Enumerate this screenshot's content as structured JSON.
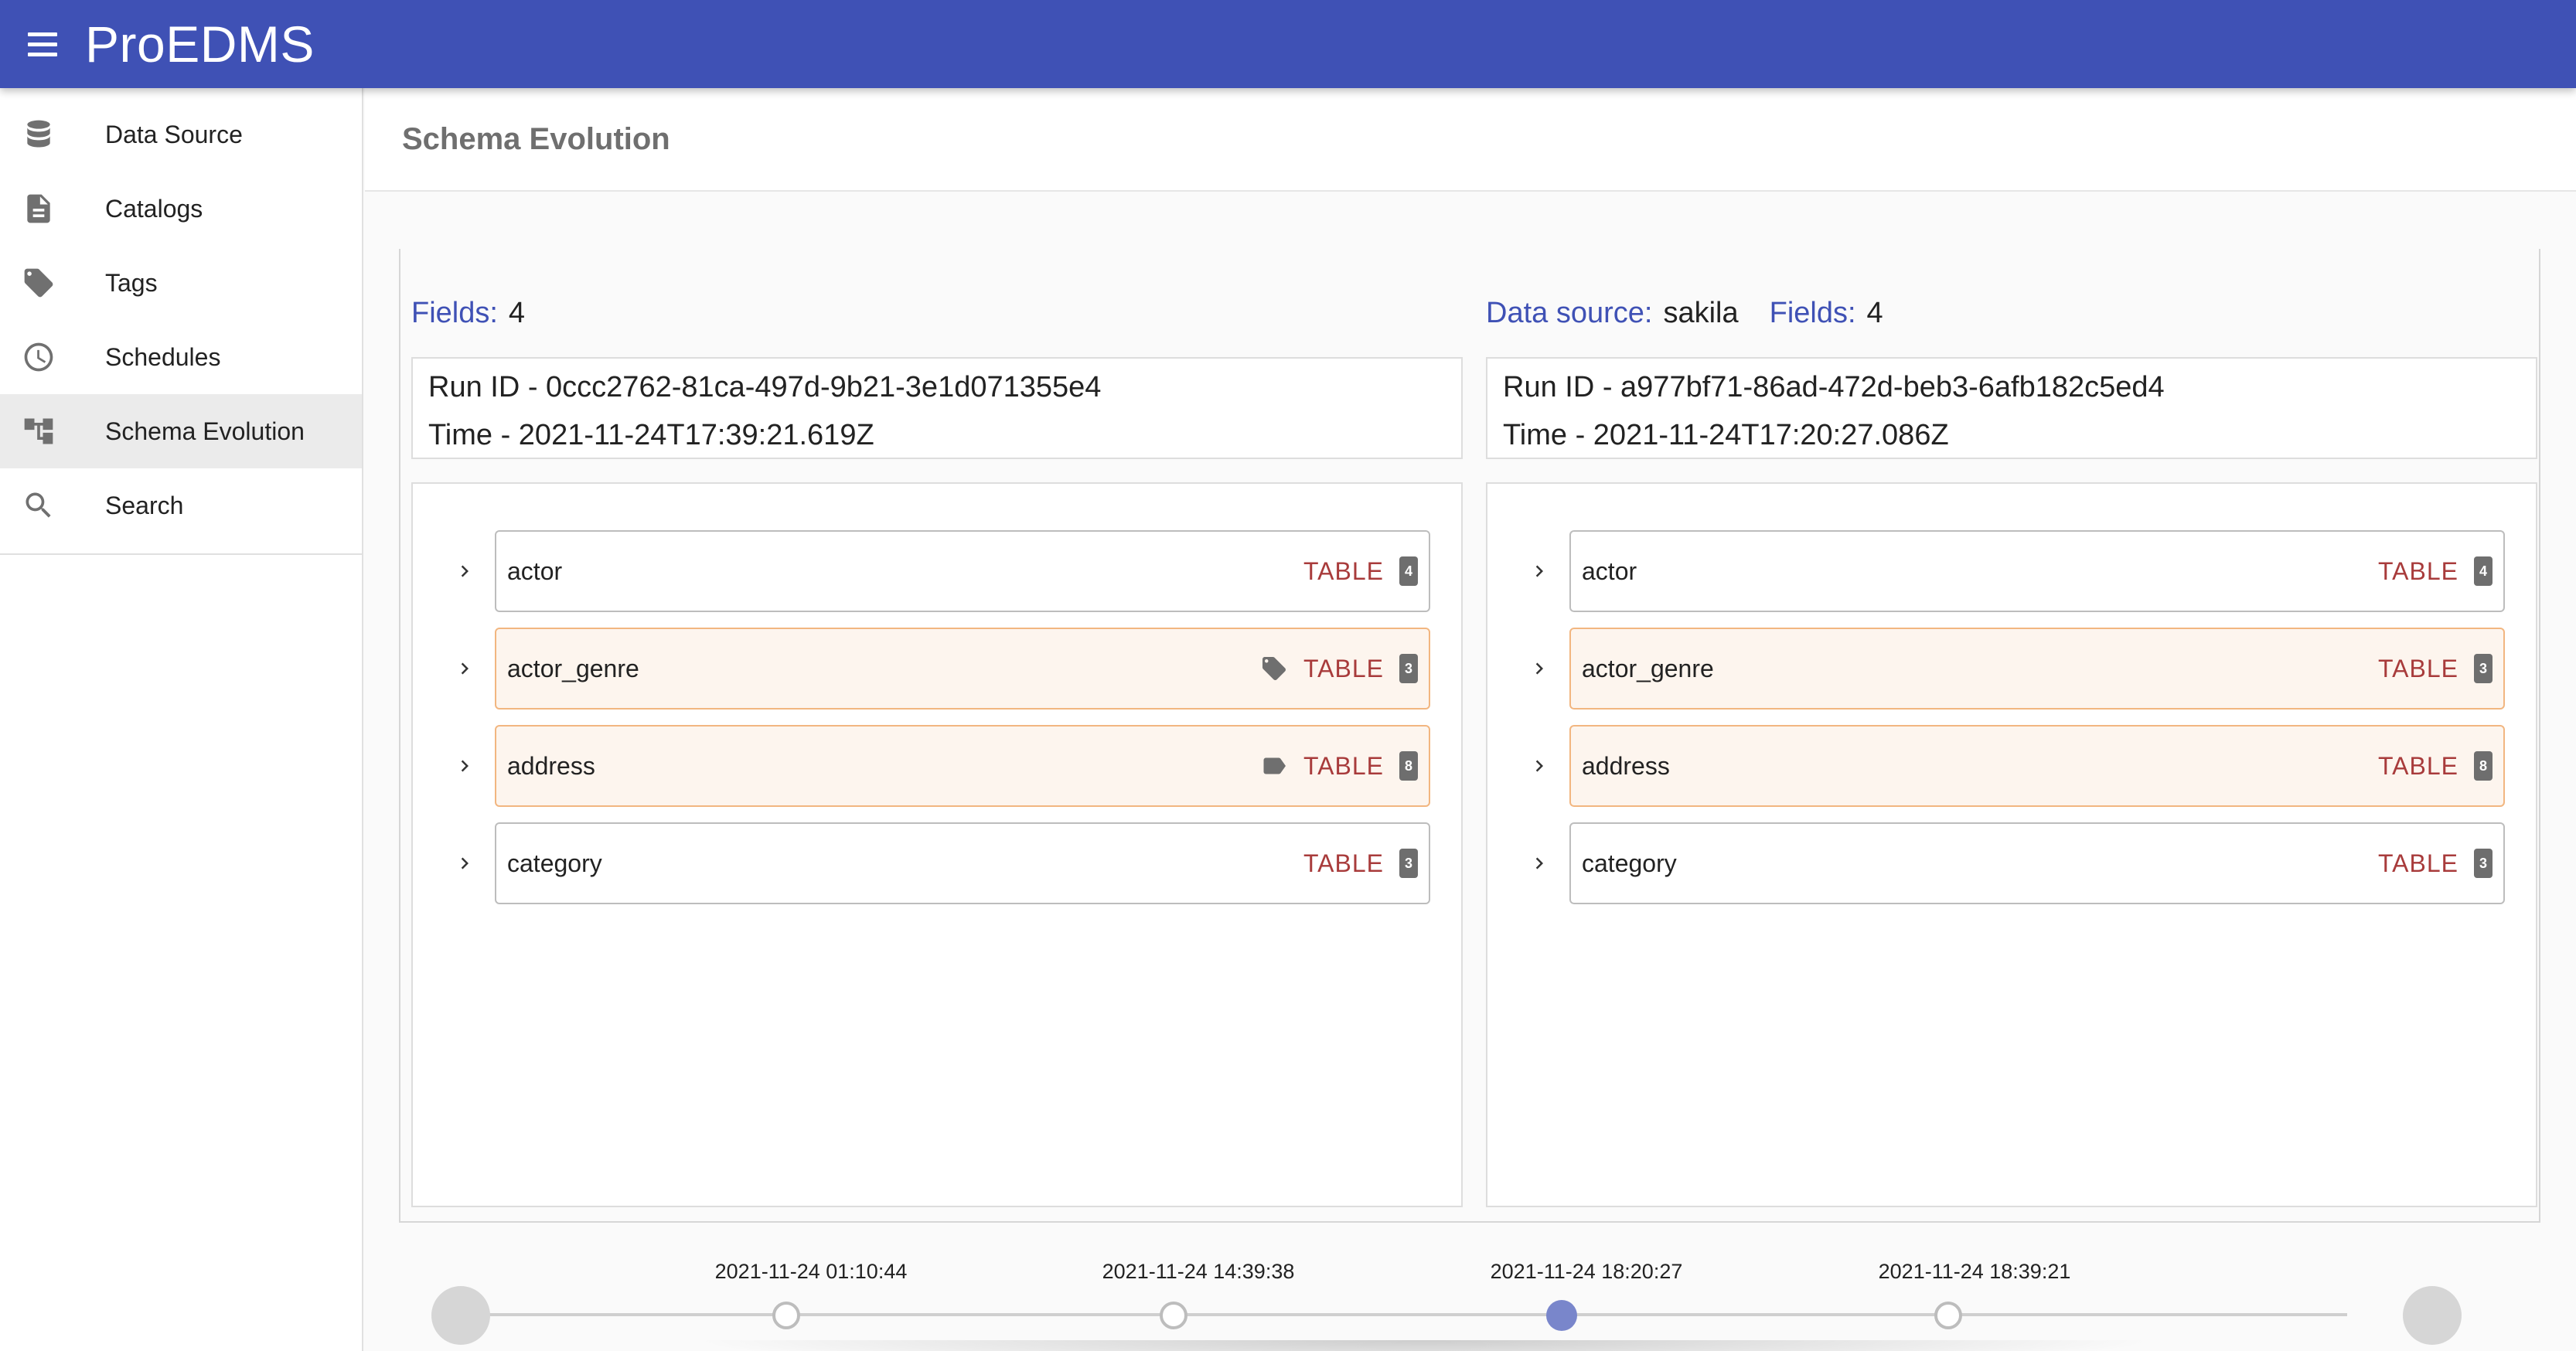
{
  "app": {
    "title": "ProEDMS"
  },
  "sidebar": {
    "items": [
      {
        "label": "Data Source",
        "icon": "database-icon"
      },
      {
        "label": "Catalogs",
        "icon": "document-icon"
      },
      {
        "label": "Tags",
        "icon": "tag-icon"
      },
      {
        "label": "Schedules",
        "icon": "clock-icon"
      },
      {
        "label": "Schema Evolution",
        "icon": "schema-tree-icon",
        "active": true
      },
      {
        "label": "Search",
        "icon": "search-icon"
      }
    ]
  },
  "page": {
    "title": "Schema Evolution"
  },
  "left_panel": {
    "fields_label": "Fields:",
    "fields_value": "4",
    "run_id": "Run ID - 0ccc2762-81ca-497d-9b21-3e1d071355e4",
    "time": "Time - 2021-11-24T17:39:21.619Z",
    "rows": [
      {
        "name": "actor",
        "type": "TABLE",
        "count": "4",
        "changed": false,
        "tag_icon": ""
      },
      {
        "name": "actor_genre",
        "type": "TABLE",
        "count": "3",
        "changed": true,
        "tag_icon": "tag-icon"
      },
      {
        "name": "address",
        "type": "TABLE",
        "count": "8",
        "changed": true,
        "tag_icon": "label-icon"
      },
      {
        "name": "category",
        "type": "TABLE",
        "count": "3",
        "changed": false,
        "tag_icon": ""
      }
    ]
  },
  "right_panel": {
    "source_label": "Data source:",
    "source_value": "sakila",
    "fields_label": "Fields:",
    "fields_value": "4",
    "run_id": "Run ID - a977bf71-86ad-472d-beb3-6afb182c5ed4",
    "time": "Time - 2021-11-24T17:20:27.086Z",
    "rows": [
      {
        "name": "actor",
        "type": "TABLE",
        "count": "4",
        "changed": false
      },
      {
        "name": "actor_genre",
        "type": "TABLE",
        "count": "3",
        "changed": true
      },
      {
        "name": "address",
        "type": "TABLE",
        "count": "8",
        "changed": true
      },
      {
        "name": "category",
        "type": "TABLE",
        "count": "3",
        "changed": false
      }
    ]
  },
  "timeline": {
    "points": [
      {
        "label": "2021-11-24 01:10:44",
        "selected": false
      },
      {
        "label": "2021-11-24 14:39:38",
        "selected": false
      },
      {
        "label": "2021-11-24 18:20:27",
        "selected": true
      },
      {
        "label": "2021-11-24 18:39:21",
        "selected": false
      }
    ]
  },
  "colors": {
    "appbar": "#3f51b5",
    "field_label": "#3f51b5",
    "type_text": "#a83b3b",
    "changed_border": "#f2b680",
    "changed_bg": "#fdf5ee",
    "timeline_selected": "#7986cb"
  }
}
